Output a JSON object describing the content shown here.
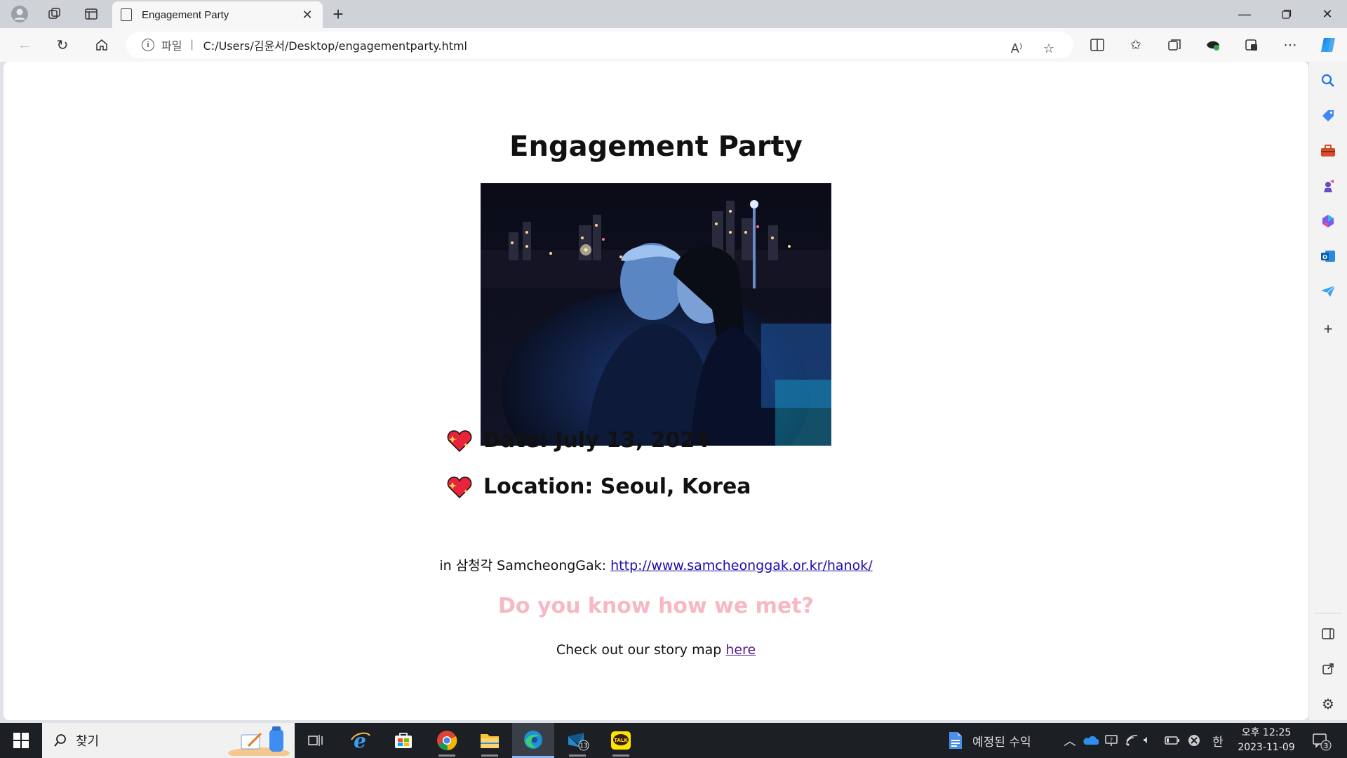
{
  "browser": {
    "tab": {
      "title": "Engagement Party"
    },
    "address": {
      "scheme_label": "파일",
      "url": "C:/Users/김윤서/Desktop/engagementparty.html"
    }
  },
  "page": {
    "heading": "Engagement Party",
    "photo_alt": "",
    "date_line": "Date: July 13, 2024",
    "location_line": "Location: Seoul, Korea",
    "venue_prefix": "in 삼청각 SamcheongGak: ",
    "venue_link": "http://www.samcheonggak.or.kr/hanok/",
    "question": "Do you know how we met?",
    "story_prefix": "Check out our story map ",
    "story_link": "here"
  },
  "taskbar": {
    "search_placeholder": "찾기",
    "weather_text": "예정된 수익",
    "ime": "한",
    "clock_time": "오후 12:25",
    "clock_date": "2023-11-09",
    "vscode_badge": "13",
    "notification_count": "3",
    "kakao_label": "TALK"
  },
  "colors": {
    "question_pink": "#f7b8c4",
    "link_blue": "#1a0dab",
    "visited_purple": "#551a8b",
    "edge_accent": "#1a73e8"
  },
  "icons": [
    "profile-icon",
    "workspaces-icon",
    "tab-actions-icon",
    "page-icon",
    "close-icon",
    "plus-icon",
    "minimize-icon",
    "restore-icon",
    "back-icon",
    "refresh-icon",
    "home-icon",
    "info-icon",
    "read-aloud-icon",
    "favorite-star-icon",
    "split-screen-icon",
    "favorites-icon",
    "collections-icon",
    "extension-icon",
    "browser-essentials-icon",
    "more-icon",
    "copilot-icon",
    "search-icon",
    "shopping-icon",
    "tools-icon",
    "games-icon",
    "m365-icon",
    "outlook-icon",
    "drop-icon",
    "add-icon",
    "sidebar-toggle-icon",
    "external-icon",
    "settings-icon",
    "windows-start-icon",
    "task-view-icon"
  ]
}
